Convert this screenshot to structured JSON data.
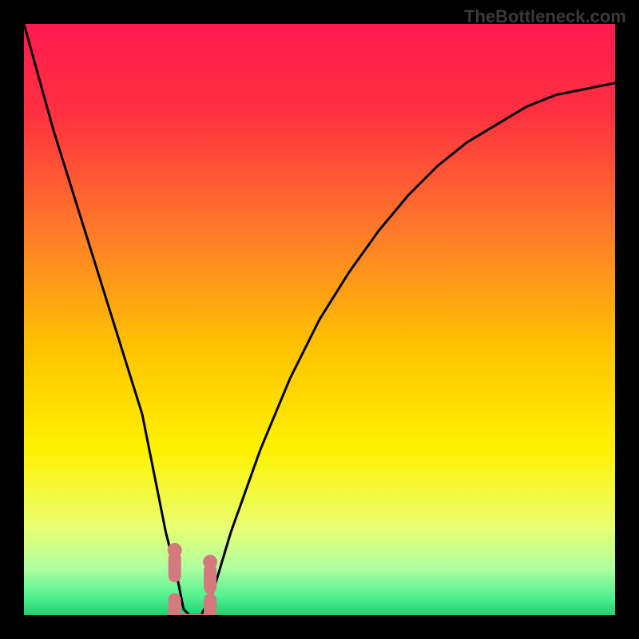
{
  "watermark": "TheBottleneck.com",
  "chart_data": {
    "type": "line",
    "title": "",
    "xlabel": "",
    "ylabel": "",
    "xlim": [
      0,
      100
    ],
    "ylim": [
      0,
      100
    ],
    "background_gradient": {
      "type": "vertical",
      "stops": [
        {
          "pos": 0.0,
          "color": "#ff1a50"
        },
        {
          "pos": 0.15,
          "color": "#ff3040"
        },
        {
          "pos": 0.35,
          "color": "#ff7a2a"
        },
        {
          "pos": 0.55,
          "color": "#ffc400"
        },
        {
          "pos": 0.72,
          "color": "#fff200"
        },
        {
          "pos": 0.85,
          "color": "#eaff70"
        },
        {
          "pos": 0.92,
          "color": "#b0ffa0"
        },
        {
          "pos": 0.97,
          "color": "#50f090"
        },
        {
          "pos": 1.0,
          "color": "#20d070"
        }
      ]
    },
    "series": [
      {
        "name": "bottleneck-curve",
        "color": "#000000",
        "x": [
          0,
          5,
          10,
          15,
          20,
          22,
          24,
          26,
          27,
          28,
          30,
          32,
          35,
          40,
          45,
          50,
          55,
          60,
          65,
          70,
          75,
          80,
          85,
          90,
          95,
          100
        ],
        "y": [
          100,
          82,
          66,
          50,
          34,
          24,
          14,
          6,
          1,
          0,
          0,
          4,
          14,
          28,
          40,
          50,
          58,
          65,
          71,
          76,
          80,
          83,
          86,
          88,
          89,
          90
        ]
      }
    ],
    "markers": [
      {
        "name": "marker-left",
        "color": "#d47a7e",
        "x": 25.5,
        "y": 8,
        "shape": "round-tick"
      },
      {
        "name": "marker-right",
        "color": "#d47a7e",
        "x": 31.5,
        "y": 6,
        "shape": "round-tick"
      },
      {
        "name": "marker-bottom-bracket",
        "color": "#d47a7e",
        "x_from": 25.5,
        "x_to": 31.5,
        "y": 1,
        "shape": "bracket"
      }
    ]
  }
}
